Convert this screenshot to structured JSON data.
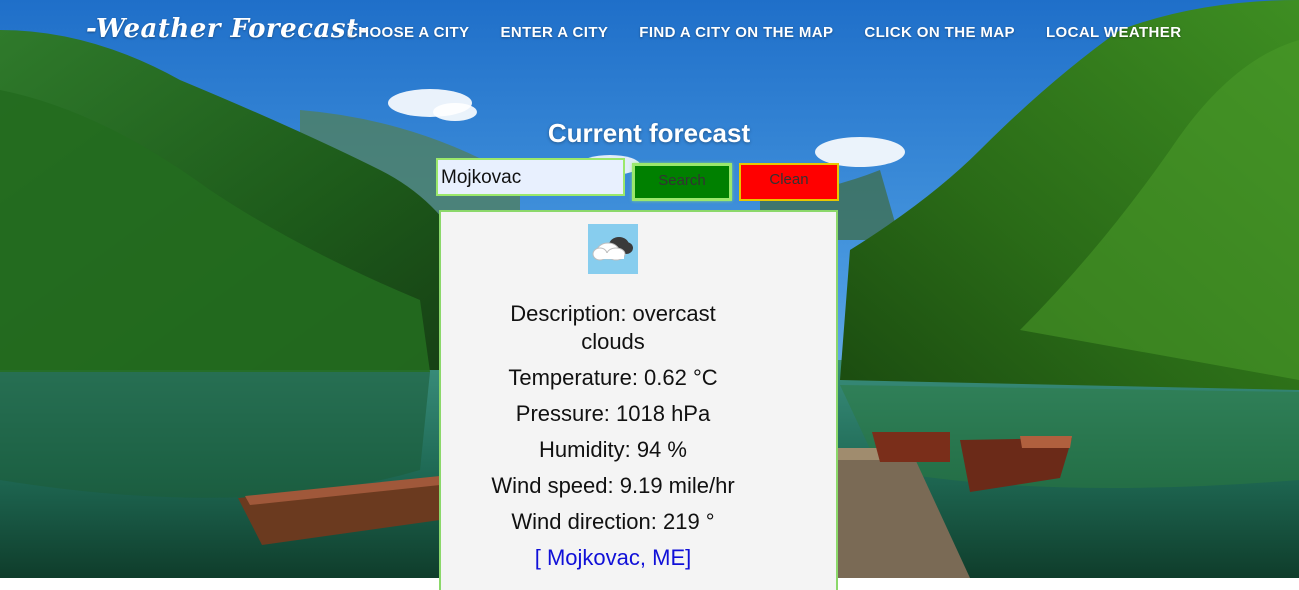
{
  "header": {
    "logo": "-Weather Forecast-",
    "nav": [
      {
        "label": "CHOOSE A CITY"
      },
      {
        "label": "ENTER A CITY"
      },
      {
        "label": "FIND A CITY ON THE MAP"
      },
      {
        "label": "CLICK ON THE MAP"
      },
      {
        "label": "LOCAL WEATHER"
      }
    ]
  },
  "main": {
    "title": "Current forecast",
    "search": {
      "value": "Mojkovac"
    },
    "search_button": "Search",
    "clean_button": "Clean",
    "weather": {
      "icon": "cloud-icon",
      "description": "Description: overcast clouds",
      "temperature": "Temperature: 0.62 °C",
      "pressure": "Pressure: 1018 hPa",
      "humidity": "Humidity: 94 %",
      "wind_speed": "Wind speed: 9.19 mile/hr",
      "wind_direction": "Wind direction: 219 °",
      "location": "[ Mojkovac, ME]"
    }
  },
  "colors": {
    "search_button": "#008000",
    "clean_button": "#ff0000",
    "input_border": "#9be86b",
    "link": "#1010d8"
  }
}
